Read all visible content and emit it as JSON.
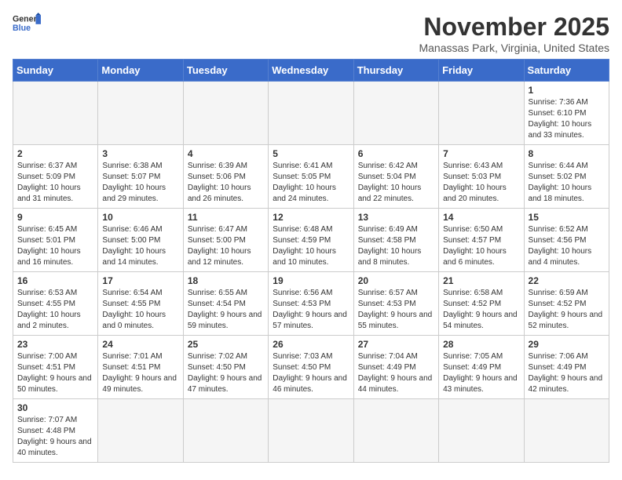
{
  "header": {
    "logo_text_general": "General",
    "logo_text_blue": "Blue",
    "month": "November 2025",
    "location": "Manassas Park, Virginia, United States"
  },
  "weekdays": [
    "Sunday",
    "Monday",
    "Tuesday",
    "Wednesday",
    "Thursday",
    "Friday",
    "Saturday"
  ],
  "weeks": [
    [
      {
        "day": "",
        "info": ""
      },
      {
        "day": "",
        "info": ""
      },
      {
        "day": "",
        "info": ""
      },
      {
        "day": "",
        "info": ""
      },
      {
        "day": "",
        "info": ""
      },
      {
        "day": "",
        "info": ""
      },
      {
        "day": "1",
        "info": "Sunrise: 7:36 AM\nSunset: 6:10 PM\nDaylight: 10 hours and 33 minutes."
      }
    ],
    [
      {
        "day": "2",
        "info": "Sunrise: 6:37 AM\nSunset: 5:09 PM\nDaylight: 10 hours and 31 minutes."
      },
      {
        "day": "3",
        "info": "Sunrise: 6:38 AM\nSunset: 5:07 PM\nDaylight: 10 hours and 29 minutes."
      },
      {
        "day": "4",
        "info": "Sunrise: 6:39 AM\nSunset: 5:06 PM\nDaylight: 10 hours and 26 minutes."
      },
      {
        "day": "5",
        "info": "Sunrise: 6:41 AM\nSunset: 5:05 PM\nDaylight: 10 hours and 24 minutes."
      },
      {
        "day": "6",
        "info": "Sunrise: 6:42 AM\nSunset: 5:04 PM\nDaylight: 10 hours and 22 minutes."
      },
      {
        "day": "7",
        "info": "Sunrise: 6:43 AM\nSunset: 5:03 PM\nDaylight: 10 hours and 20 minutes."
      },
      {
        "day": "8",
        "info": "Sunrise: 6:44 AM\nSunset: 5:02 PM\nDaylight: 10 hours and 18 minutes."
      }
    ],
    [
      {
        "day": "9",
        "info": "Sunrise: 6:45 AM\nSunset: 5:01 PM\nDaylight: 10 hours and 16 minutes."
      },
      {
        "day": "10",
        "info": "Sunrise: 6:46 AM\nSunset: 5:00 PM\nDaylight: 10 hours and 14 minutes."
      },
      {
        "day": "11",
        "info": "Sunrise: 6:47 AM\nSunset: 5:00 PM\nDaylight: 10 hours and 12 minutes."
      },
      {
        "day": "12",
        "info": "Sunrise: 6:48 AM\nSunset: 4:59 PM\nDaylight: 10 hours and 10 minutes."
      },
      {
        "day": "13",
        "info": "Sunrise: 6:49 AM\nSunset: 4:58 PM\nDaylight: 10 hours and 8 minutes."
      },
      {
        "day": "14",
        "info": "Sunrise: 6:50 AM\nSunset: 4:57 PM\nDaylight: 10 hours and 6 minutes."
      },
      {
        "day": "15",
        "info": "Sunrise: 6:52 AM\nSunset: 4:56 PM\nDaylight: 10 hours and 4 minutes."
      }
    ],
    [
      {
        "day": "16",
        "info": "Sunrise: 6:53 AM\nSunset: 4:55 PM\nDaylight: 10 hours and 2 minutes."
      },
      {
        "day": "17",
        "info": "Sunrise: 6:54 AM\nSunset: 4:55 PM\nDaylight: 10 hours and 0 minutes."
      },
      {
        "day": "18",
        "info": "Sunrise: 6:55 AM\nSunset: 4:54 PM\nDaylight: 9 hours and 59 minutes."
      },
      {
        "day": "19",
        "info": "Sunrise: 6:56 AM\nSunset: 4:53 PM\nDaylight: 9 hours and 57 minutes."
      },
      {
        "day": "20",
        "info": "Sunrise: 6:57 AM\nSunset: 4:53 PM\nDaylight: 9 hours and 55 minutes."
      },
      {
        "day": "21",
        "info": "Sunrise: 6:58 AM\nSunset: 4:52 PM\nDaylight: 9 hours and 54 minutes."
      },
      {
        "day": "22",
        "info": "Sunrise: 6:59 AM\nSunset: 4:52 PM\nDaylight: 9 hours and 52 minutes."
      }
    ],
    [
      {
        "day": "23",
        "info": "Sunrise: 7:00 AM\nSunset: 4:51 PM\nDaylight: 9 hours and 50 minutes."
      },
      {
        "day": "24",
        "info": "Sunrise: 7:01 AM\nSunset: 4:51 PM\nDaylight: 9 hours and 49 minutes."
      },
      {
        "day": "25",
        "info": "Sunrise: 7:02 AM\nSunset: 4:50 PM\nDaylight: 9 hours and 47 minutes."
      },
      {
        "day": "26",
        "info": "Sunrise: 7:03 AM\nSunset: 4:50 PM\nDaylight: 9 hours and 46 minutes."
      },
      {
        "day": "27",
        "info": "Sunrise: 7:04 AM\nSunset: 4:49 PM\nDaylight: 9 hours and 44 minutes."
      },
      {
        "day": "28",
        "info": "Sunrise: 7:05 AM\nSunset: 4:49 PM\nDaylight: 9 hours and 43 minutes."
      },
      {
        "day": "29",
        "info": "Sunrise: 7:06 AM\nSunset: 4:49 PM\nDaylight: 9 hours and 42 minutes."
      }
    ],
    [
      {
        "day": "30",
        "info": "Sunrise: 7:07 AM\nSunset: 4:48 PM\nDaylight: 9 hours and 40 minutes."
      },
      {
        "day": "",
        "info": ""
      },
      {
        "day": "",
        "info": ""
      },
      {
        "day": "",
        "info": ""
      },
      {
        "day": "",
        "info": ""
      },
      {
        "day": "",
        "info": ""
      },
      {
        "day": "",
        "info": ""
      }
    ]
  ]
}
